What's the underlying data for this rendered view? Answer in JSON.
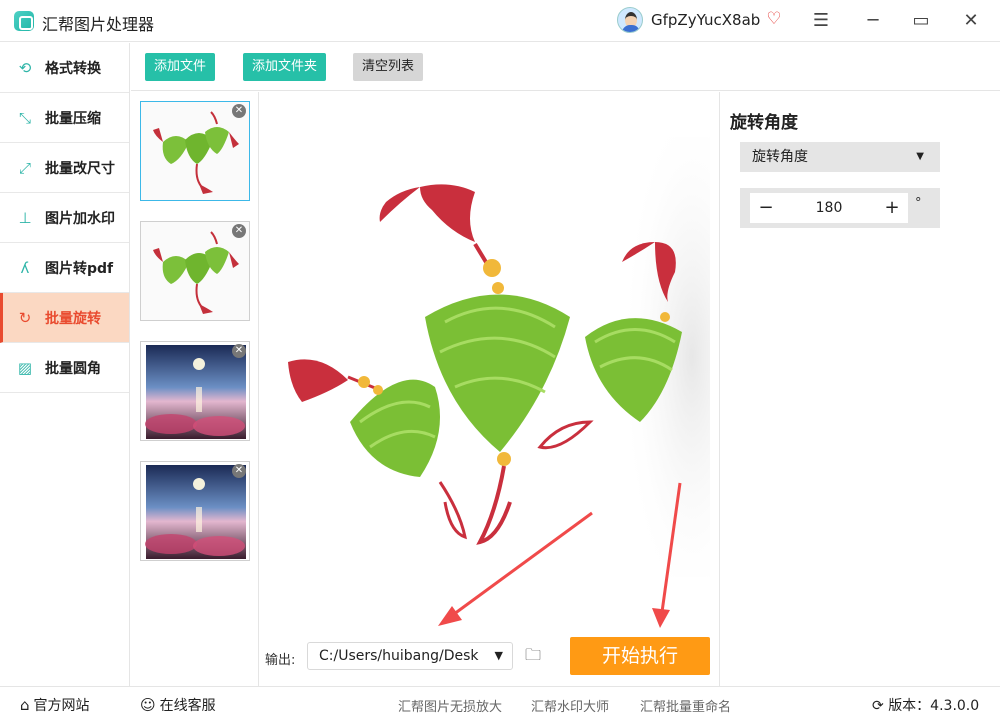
{
  "app": {
    "title": "汇帮图片处理器",
    "username": "GfpZyYucX8ab"
  },
  "window": {
    "menu_icon": "hamburger-icon",
    "minimize_icon": "minimize-icon",
    "maximize_icon": "maximize-icon",
    "close_icon": "close-icon"
  },
  "sidebar": {
    "items": [
      {
        "label": "格式转换",
        "icon": "format-convert-icon",
        "active": false
      },
      {
        "label": "批量压缩",
        "icon": "compress-icon",
        "active": false
      },
      {
        "label": "批量改尺寸",
        "icon": "resize-icon",
        "active": false
      },
      {
        "label": "图片加水印",
        "icon": "watermark-icon",
        "active": false
      },
      {
        "label": "图片转pdf",
        "icon": "pdf-icon",
        "active": false
      },
      {
        "label": "批量旋转",
        "icon": "rotate-icon",
        "active": true
      },
      {
        "label": "批量圆角",
        "icon": "rounded-corner-icon",
        "active": false
      }
    ]
  },
  "toolbar": {
    "add_file": "添加文件",
    "add_folder": "添加文件夹",
    "clear_list": "清空列表"
  },
  "thumbnails": [
    {
      "image": "zongzi",
      "selected": true
    },
    {
      "image": "zongzi",
      "selected": false
    },
    {
      "image": "lake-moon",
      "selected": false
    },
    {
      "image": "lake-moon",
      "selected": false
    }
  ],
  "output": {
    "label": "输出:",
    "path": "C:/Users/huibang/Desk"
  },
  "actions": {
    "start": "开始执行"
  },
  "right_panel": {
    "title": "旋转角度",
    "select_value": "旋转角度",
    "stepper": {
      "minus": "−",
      "value": "180",
      "plus": "+",
      "unit": "°"
    }
  },
  "footer": {
    "website": "官方网站",
    "service": "在线客服",
    "links": [
      "汇帮图片无损放大",
      "汇帮水印大师",
      "汇帮批量重命名"
    ],
    "version": "版本：4.3.0.0"
  },
  "colors": {
    "accent_teal": "#26c0a8",
    "active_orange": "#e94b2f",
    "start_button": "#ff9a14"
  }
}
